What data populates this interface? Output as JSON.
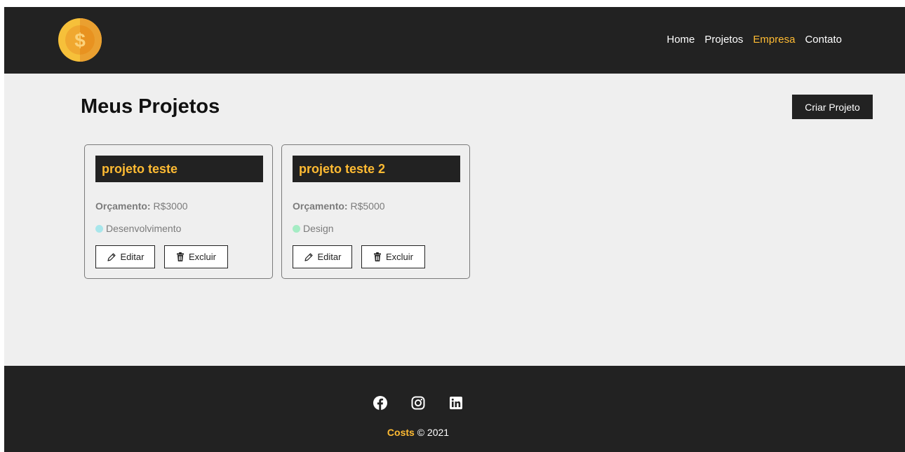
{
  "colors": {
    "dark": "#222222",
    "accent": "#ffbb33",
    "background": "#efefef"
  },
  "navbar": {
    "logo_icon": "coin-dollar-icon",
    "links": [
      {
        "label": "Home",
        "active": false
      },
      {
        "label": "Projetos",
        "active": false
      },
      {
        "label": "Empresa",
        "active": true
      },
      {
        "label": "Contato",
        "active": false
      }
    ]
  },
  "main": {
    "title": "Meus Projetos",
    "create_button": "Criar Projeto"
  },
  "projects": [
    {
      "name": "projeto teste",
      "budget_label": "Orçamento:",
      "budget_value": "R$3000",
      "category": "Desenvolvimento",
      "category_color": "#a8e6eb",
      "edit_label": "Editar",
      "delete_label": "Excluir"
    },
    {
      "name": "projeto teste 2",
      "budget_label": "Orçamento:",
      "budget_value": "R$5000",
      "category": "Design",
      "category_color": "#a5ecc4",
      "edit_label": "Editar",
      "delete_label": "Excluir"
    }
  ],
  "footer": {
    "social_icons": [
      "facebook-icon",
      "instagram-icon",
      "linkedin-icon"
    ],
    "brand": "Costs",
    "copyright": "© 2021"
  }
}
